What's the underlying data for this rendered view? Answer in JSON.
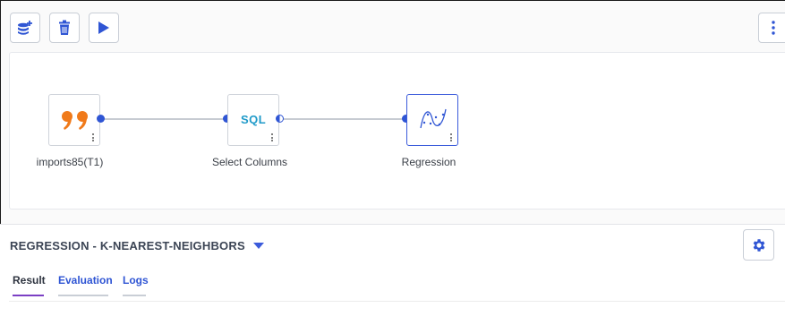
{
  "toolbar": {
    "buttons": [
      {
        "icon": "add-dataset-icon"
      },
      {
        "icon": "trash-icon"
      },
      {
        "icon": "play-icon"
      }
    ],
    "more_icon": "vertical-ellipsis-icon"
  },
  "pipeline": {
    "nodes": [
      {
        "label": "imports85(T1)",
        "icon": "quote-icon"
      },
      {
        "label": "Select Columns",
        "icon": "sql-icon",
        "icon_text": "SQL"
      },
      {
        "label": "Regression",
        "icon": "regression-curve-icon"
      }
    ]
  },
  "panel": {
    "title": "REGRESSION - K-NEAREST-NEIGHBORS",
    "settings_icon": "gear-icon",
    "tabs": [
      {
        "label": "Result",
        "active": true
      },
      {
        "label": "Evaluation",
        "active": false
      },
      {
        "label": "Logs",
        "active": false
      }
    ]
  },
  "colors": {
    "accent": "#2f55d4",
    "quote_orange": "#f07a1a",
    "sql_teal": "#1f9ac9",
    "active_tab": "#7b3fc4"
  }
}
